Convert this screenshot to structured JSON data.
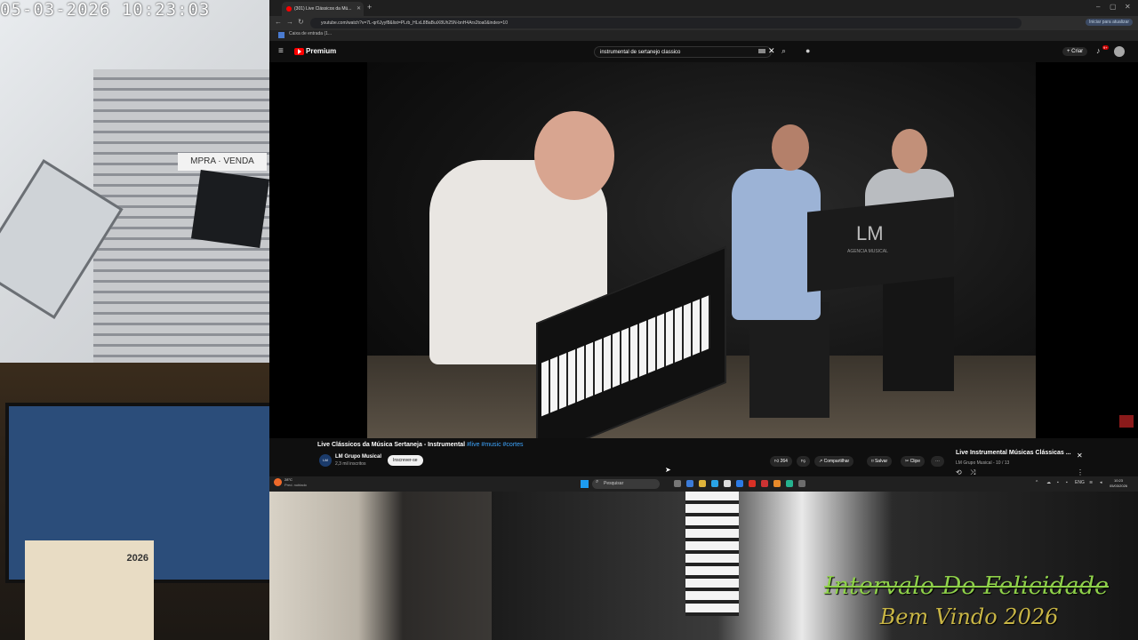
{
  "camera": {
    "timestamp": "05-03-2026  10:23:03",
    "sign_text": "MPRA · VENDA",
    "calendar_year": "2026"
  },
  "overlay": {
    "line1": "Intervalo Do Felicidade",
    "line2": "Bem Vindo 2026"
  },
  "browser": {
    "tab_title": "(301) Live Clássicos da Mú...",
    "url": "youtube.com/watch?v=7L-qr6Jyyf8&list=PLrb_HLxL8BaBuiX8Uh25N-bnH4Ars2toa0&index=10",
    "signin_label": "Iniciar para atualizar",
    "bookmark": "Caixa de entrada (1..."
  },
  "youtube": {
    "logo_text": "Premium",
    "search_query": "instrumental de sertanejo classico",
    "create_label": "+ Criar",
    "notifications_badge": "9+",
    "video": {
      "title": "Live Clássicos da Música Sertaneja - Instrumental",
      "hashtags": "#live #music #cortes",
      "stand_logo": "LM",
      "stand_sub": "AGENCIA MUSICAL"
    },
    "channel": {
      "name": "LM Grupo Musical",
      "subscribers": "2,3 mil inscritos",
      "avatar_text": "LM"
    },
    "subscribe_label": "Inscrever-se",
    "actions": {
      "likes": "264",
      "share": "Compartilhar",
      "save": "Salvar",
      "clip": "Clipe"
    },
    "playlist": {
      "title": "Live Instrumental Músicas Clássicas ...",
      "subtitle": "LM Grupo Musical - 10 / 13"
    }
  },
  "taskbar": {
    "weather_temp": "28°C",
    "weather_desc": "Pred. nublado",
    "search_placeholder": "Pesquisar",
    "lang": "ENG",
    "time": "10:23",
    "date": "05/03/2026"
  },
  "colors": {
    "yt_red": "#ff0000",
    "overlay_green": "#8fd14a",
    "overlay_gold": "#c8b545",
    "link_blue": "#3ea6ff"
  }
}
